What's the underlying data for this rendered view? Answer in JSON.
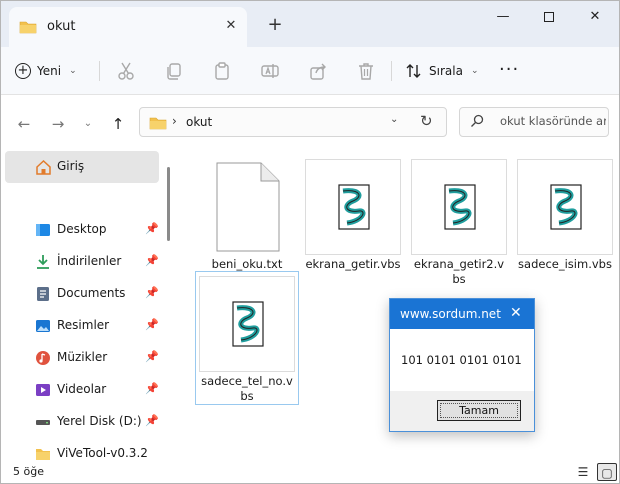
{
  "window": {
    "tab_title": "okut",
    "new_tab_glyph": "+",
    "close_glyph": "✕",
    "min_glyph": "—",
    "icons": [
      "folder-icon",
      "close-icon",
      "plus-icon",
      "minimize-icon",
      "maximize-icon"
    ]
  },
  "toolbar": {
    "new_label": "Yeni",
    "sort_label": "Sırala",
    "more_glyph": "···",
    "icons": [
      "cut-icon",
      "copy-icon",
      "paste-icon",
      "rename-icon",
      "share-icon",
      "delete-icon",
      "sort-icon"
    ]
  },
  "address": {
    "path": "okut",
    "separator": "›",
    "search_placeholder": "okut klasöründe ara"
  },
  "sidebar": {
    "home": "Giriş",
    "items": [
      {
        "label": "Desktop",
        "icon": "desktop-icon",
        "color": "#1e88e5"
      },
      {
        "label": "İndirilenler",
        "icon": "download-icon",
        "color": "#2e9d5a"
      },
      {
        "label": "Documents",
        "icon": "document-icon",
        "color": "#5c6f8a"
      },
      {
        "label": "Resimler",
        "icon": "pictures-icon",
        "color": "#1976d2"
      },
      {
        "label": "Müzikler",
        "icon": "music-icon",
        "color": "#e0533e"
      },
      {
        "label": "Videolar",
        "icon": "video-icon",
        "color": "#7b3fc4"
      },
      {
        "label": "Yerel Disk (D:)",
        "icon": "drive-icon",
        "color": "#555555"
      },
      {
        "label": "ViVeTool-v0.3.2",
        "icon": "folder-icon",
        "color": "#f2c14e"
      }
    ]
  },
  "files": [
    {
      "name": "beni_oku.txt",
      "type": "txt"
    },
    {
      "name": "ekrana_getir.vbs",
      "type": "vbs"
    },
    {
      "name": "ekrana_getir2.vbs",
      "type": "vbs"
    },
    {
      "name": "sadece_isim.vbs",
      "type": "vbs"
    },
    {
      "name": "sadece_tel_no.vbs",
      "type": "vbs"
    }
  ],
  "status": {
    "count": "5 öğe"
  },
  "dialog": {
    "title": "www.sordum.net",
    "message": "101 0101 0101 0101",
    "ok_label": "Tamam"
  },
  "colors": {
    "accent": "#1a74d4",
    "folder": "#f2c14e"
  }
}
